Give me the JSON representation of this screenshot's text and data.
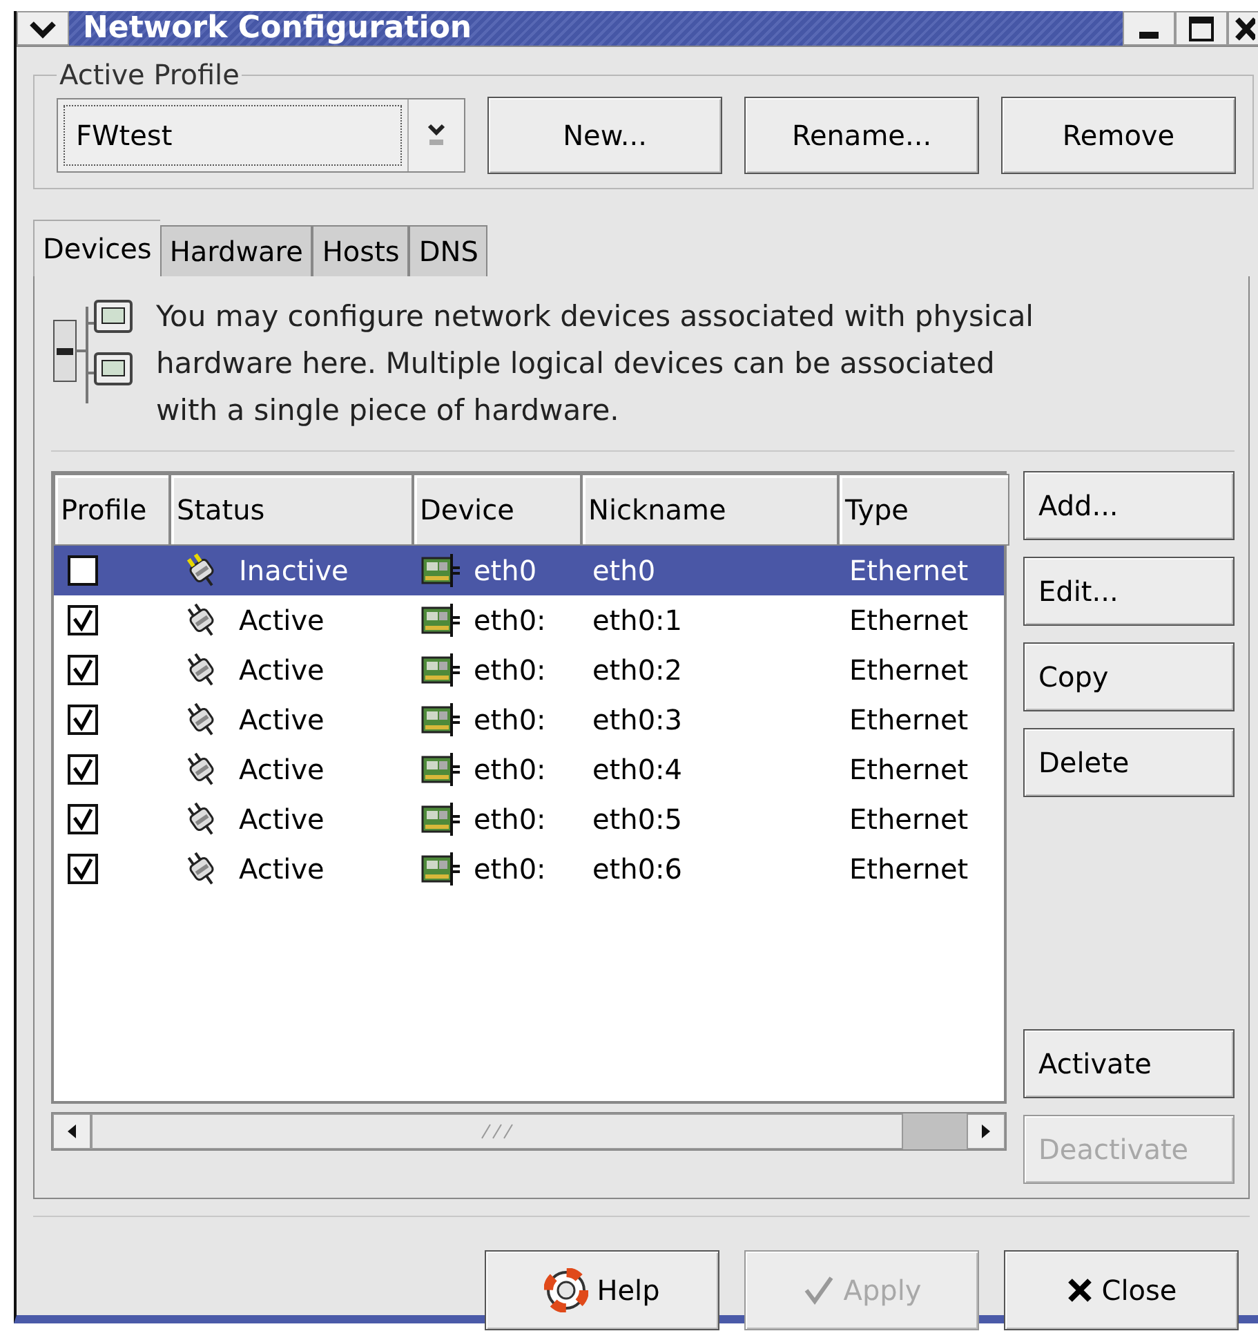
{
  "window": {
    "title": "Network Configuration"
  },
  "active_profile": {
    "label": "Active Profile",
    "value": "FWtest",
    "buttons": [
      {
        "label": "New...",
        "disabled": false
      },
      {
        "label": "Rename...",
        "disabled": false
      },
      {
        "label": "Remove",
        "disabled": false
      }
    ]
  },
  "tabs": [
    {
      "label": "Devices",
      "selected": true
    },
    {
      "label": "Hardware",
      "selected": false
    },
    {
      "label": "Hosts",
      "selected": false
    },
    {
      "label": "DNS",
      "selected": false
    }
  ],
  "description": "You may configure network devices associated with physical hardware here.  Multiple logical devices can be associated with a single piece of hardware.",
  "table": {
    "columns": [
      "Profile",
      "Status",
      "Device",
      "Nickname",
      "Type"
    ],
    "rows": [
      {
        "checked": false,
        "selected": true,
        "status": "Inactive",
        "active": false,
        "device": "eth0",
        "nickname": "eth0",
        "type": "Ethernet"
      },
      {
        "checked": true,
        "selected": false,
        "status": "Active",
        "active": true,
        "device": "eth0:",
        "nickname": "eth0:1",
        "type": "Ethernet"
      },
      {
        "checked": true,
        "selected": false,
        "status": "Active",
        "active": true,
        "device": "eth0:",
        "nickname": "eth0:2",
        "type": "Ethernet"
      },
      {
        "checked": true,
        "selected": false,
        "status": "Active",
        "active": true,
        "device": "eth0:",
        "nickname": "eth0:3",
        "type": "Ethernet"
      },
      {
        "checked": true,
        "selected": false,
        "status": "Active",
        "active": true,
        "device": "eth0:",
        "nickname": "eth0:4",
        "type": "Ethernet"
      },
      {
        "checked": true,
        "selected": false,
        "status": "Active",
        "active": true,
        "device": "eth0:",
        "nickname": "eth0:5",
        "type": "Ethernet"
      },
      {
        "checked": true,
        "selected": false,
        "status": "Active",
        "active": true,
        "device": "eth0:",
        "nickname": "eth0:6",
        "type": "Ethernet"
      }
    ]
  },
  "side_buttons": [
    {
      "label": "Add...",
      "disabled": false
    },
    {
      "label": "Edit...",
      "disabled": false
    },
    {
      "label": "Copy",
      "disabled": false
    },
    {
      "label": "Delete",
      "disabled": false
    }
  ],
  "state_buttons": [
    {
      "label": "Activate",
      "disabled": false
    },
    {
      "label": "Deactivate",
      "disabled": true
    }
  ],
  "dialog_buttons": [
    {
      "label": "Help",
      "kind": "help",
      "disabled": false
    },
    {
      "label": "Apply",
      "kind": "apply",
      "disabled": true
    },
    {
      "label": "Close",
      "kind": "close",
      "disabled": false
    }
  ]
}
